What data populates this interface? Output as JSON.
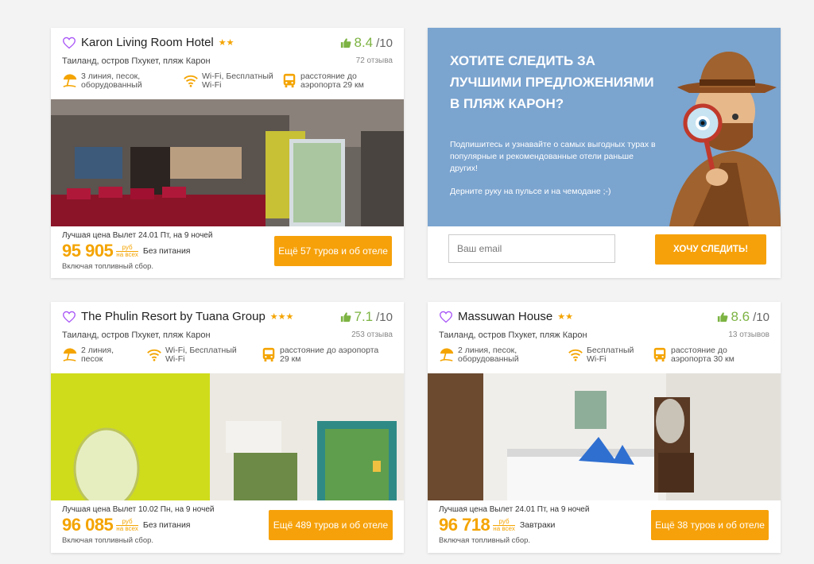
{
  "hotels": [
    {
      "name": "Karon Living Room Hotel",
      "stars": "★★",
      "rating": "8.4",
      "rating_den": "/10",
      "location": "Таиланд, остров Пхукет, пляж Карон",
      "reviews": "72 отзыва",
      "features": [
        "3 линия, песок, оборудованный",
        "Wi-Fi, Бесплатный Wi-Fi",
        "расстояние до аэропорта 29 км"
      ],
      "best_price_text": "Лучшая цена Вылет 24.01 Пт, на 9 ночей",
      "price": "95 905",
      "currency": "руб",
      "currency_sub": "на всех",
      "meal": "Без питания",
      "fuel": "Включая топливный сбор.",
      "button": "Ещё 57 туров и об отеле"
    },
    {
      "name": "The Phulin Resort by Tuana Group",
      "stars": "★★★",
      "rating": "7.1",
      "rating_den": "/10",
      "location": "Таиланд, остров Пхукет, пляж Карон",
      "reviews": "253 отзыва",
      "features": [
        "2 линия, песок",
        "Wi-Fi, Бесплатный Wi-Fi",
        "расстояние до аэропорта 29 км"
      ],
      "best_price_text": "Лучшая цена Вылет 10.02 Пн, на 9 ночей",
      "price": "96 085",
      "currency": "руб",
      "currency_sub": "на всех",
      "meal": "Без питания",
      "fuel": "Включая топливный сбор.",
      "button": "Ещё 489 туров и об отеле"
    },
    {
      "name": "Massuwan House",
      "stars": "★★",
      "rating": "8.6",
      "rating_den": "/10",
      "location": "Таиланд, остров Пхукет, пляж Карон",
      "reviews": "13 отзывов",
      "features": [
        "2 линия, песок, оборудованный",
        "Бесплатный Wi-Fi",
        "расстояние до аэропорта 30 км"
      ],
      "best_price_text": "Лучшая цена Вылет 24.01 Пт, на 9 ночей",
      "price": "96 718",
      "currency": "руб",
      "currency_sub": "на всех",
      "meal": "Завтраки",
      "fuel": "Включая топливный сбор.",
      "button": "Ещё 38 туров и об отеле"
    }
  ],
  "promo": {
    "title": "ХОТИТЕ СЛЕДИТЬ ЗА ЛУЧШИМИ ПРЕДЛОЖЕНИЯМИ В ПЛЯЖ КАРОН?",
    "text1": "Подпишитесь и узнавайте о самых выгодных турах в популярные и рекомендованные отели раньше других!",
    "text2": "Дерните руку на пульсе и на чемодане ;-)",
    "email_placeholder": "Ваш email",
    "button": "ХОЧУ СЛЕДИТЬ!"
  },
  "colors": {
    "accent": "#f6a10a",
    "price": "#f4a400",
    "rating": "#7cb342",
    "promo_bg": "#7ba4cf",
    "heart": "#a855f7"
  }
}
